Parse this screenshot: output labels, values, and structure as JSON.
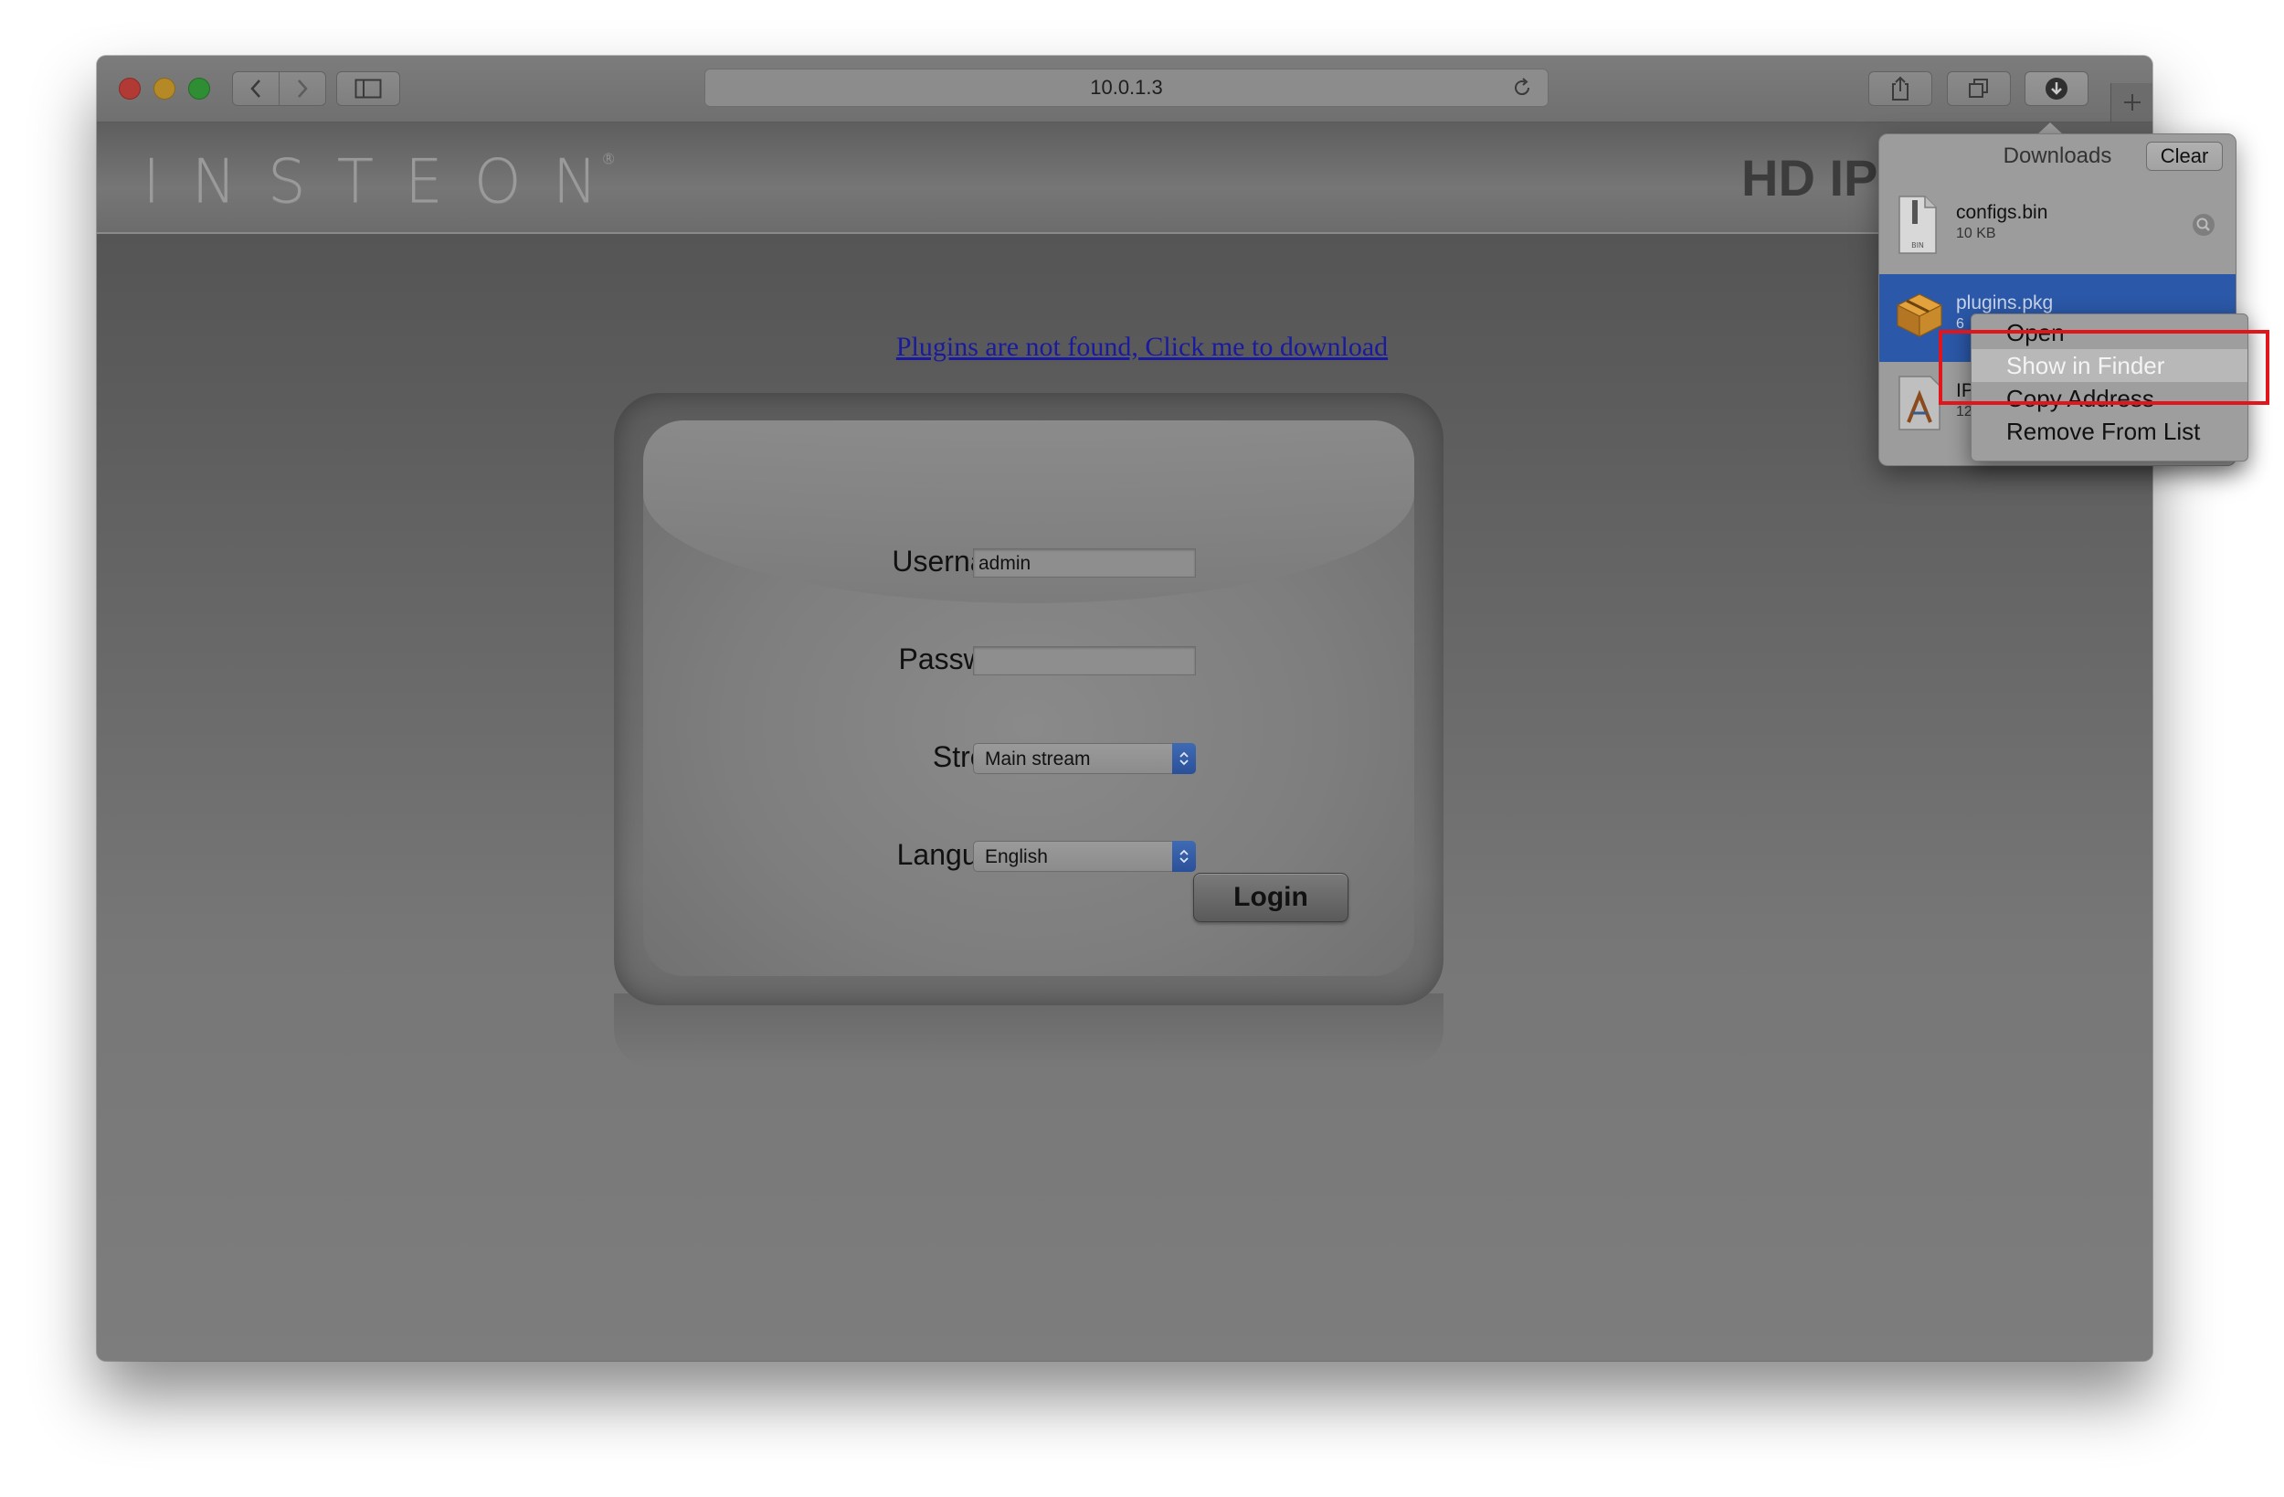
{
  "browser": {
    "url": "10.0.1.3",
    "icons": {
      "back": "chevron-left-icon",
      "forward": "chevron-right-icon",
      "sidebar": "sidebar-icon",
      "share": "share-icon",
      "tabs": "tabs-icon",
      "downloads": "download-arrow-icon",
      "new_tab": "plus-icon",
      "reload": "reload-icon"
    }
  },
  "page": {
    "logo": "INSTEON",
    "logo_mark": "®",
    "title": "HD IP",
    "plugin_link": "Plugins are not found, Click me to download",
    "login": {
      "username_label": "Username",
      "username_value": "admin",
      "password_label": "Password",
      "password_value": "",
      "stream_label": "Stream",
      "stream_value": "Main stream",
      "language_label": "Language",
      "language_value": "English",
      "login_button": "Login"
    }
  },
  "downloads": {
    "title": "Downloads",
    "clear_label": "Clear",
    "items": [
      {
        "name": "configs.bin",
        "size": "10 KB",
        "icon": "bin-file-icon"
      },
      {
        "name": "plugins.pkg",
        "size": "6",
        "icon": "package-icon"
      },
      {
        "name": "IP",
        "size": "12",
        "icon": "app-installer-icon"
      }
    ]
  },
  "context_menu": {
    "items": [
      "Open",
      "Show in Finder",
      "Copy Address",
      "Remove From List"
    ]
  },
  "colors": {
    "highlight_box": "#e0161c",
    "selected_download": "#2b58a8",
    "link": "#1a1a9e"
  }
}
